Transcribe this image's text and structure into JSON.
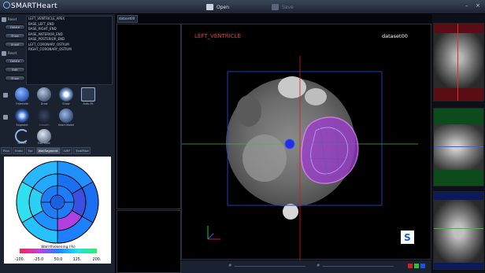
{
  "app": {
    "title": "SMARTHeart"
  },
  "toolbar": {
    "open_label": "Open",
    "save_label": "Save"
  },
  "window": {
    "minimize": "–",
    "close": "×"
  },
  "left": {
    "flag1": "Reset",
    "flag2": "Reset",
    "buttons": [
      "Delete",
      "Show",
      "Unset",
      "Delete",
      "Edit",
      "Show"
    ],
    "landmarks": [
      "LEFT_VENTRICLE_APEX",
      "BASE_LEFT_END",
      "BASE_RIGHT_END",
      "BASE_ANTERIOR_END",
      "BASE_POSTERIOR_END",
      "LEFT_CORONARY_OSTIUM",
      "RIGHT_CORONARY_OSTIUM"
    ],
    "tools1": [
      "Orientate",
      "Draw",
      "Show",
      "Auto Fit"
    ],
    "tools2": [
      "Segment",
      "Smooth",
      "Heart Model"
    ],
    "tools3": [
      "Revert",
      "Edit View"
    ]
  },
  "tabs": [
    "Plan",
    "Endo",
    "Epi",
    "WallSegment",
    "LVEF",
    "EvalMod"
  ],
  "active_tab": "WallSegment",
  "bullseye": {
    "colorbar_title": "Wall thickening (%)",
    "ticks": [
      "-100.",
      "-25.0",
      "50.0",
      "125.",
      "200."
    ],
    "colors": {
      "low": "#e8204c",
      "mid": "#20c0ff",
      "high": "#30e050"
    }
  },
  "view": {
    "tab_label": "dataset00",
    "structure_label": "LEFT_VENTRICLE",
    "dataset_label": "dataset00",
    "orientation_marker": "S"
  },
  "bottom": {
    "left_marker": "#",
    "right_marker": "#"
  },
  "colors": {
    "accent": "#2f7fe0",
    "red_label": "#e23a3a",
    "orient_box": "#1a5fd0"
  }
}
